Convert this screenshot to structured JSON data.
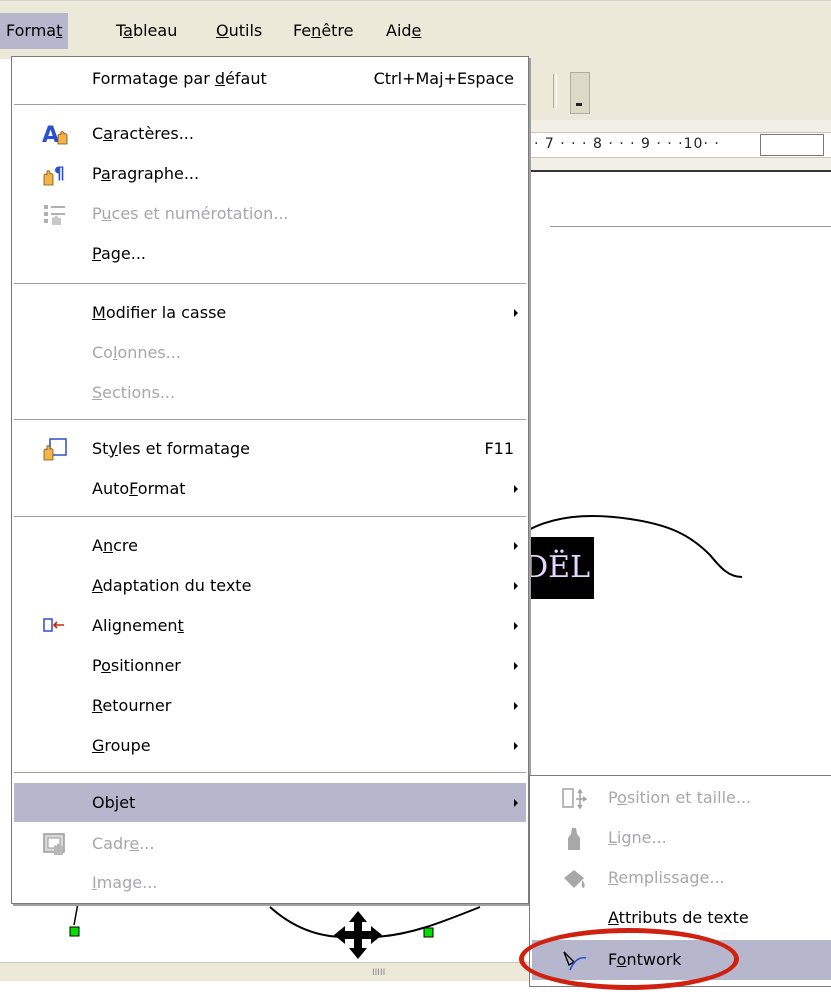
{
  "menubar": {
    "items": [
      {
        "pre": "Forma",
        "u": "t",
        "post": ""
      },
      {
        "pre": "T",
        "u": "a",
        "post": "bleau"
      },
      {
        "pre": "",
        "u": "O",
        "post": "utils"
      },
      {
        "pre": "Fe",
        "u": "n",
        "post": "être"
      },
      {
        "pre": "Aid",
        "u": "e",
        "post": ""
      }
    ]
  },
  "ruler": {
    "marks": "· 7 · · · 8 · · · 9 · · ·10· ·"
  },
  "document": {
    "text_box": "DËL"
  },
  "format_menu": {
    "items": [
      {
        "pre": "Formatage par ",
        "u": "d",
        "post": "éfaut",
        "shortcut": "Ctrl+Maj+Espace",
        "icon": "none"
      },
      {
        "pre": "C",
        "u": "a",
        "post": "ractères...",
        "icon": "character-icon"
      },
      {
        "pre": "P",
        "u": "a",
        "post": "ragraphe...",
        "icon": "paragraph-icon"
      },
      {
        "pre": "P",
        "u": "u",
        "post": "ces et numérotation...",
        "icon": "bullets-icon"
      },
      {
        "pre": "",
        "u": "P",
        "post": "age...",
        "icon": "none"
      },
      {
        "pre": "",
        "u": "M",
        "post": "odifier la casse",
        "icon": "none"
      },
      {
        "pre": "Co",
        "u": "l",
        "post": "onnes...",
        "icon": "none"
      },
      {
        "pre": "",
        "u": "S",
        "post": "ections...",
        "icon": "none"
      },
      {
        "pre": "St",
        "u": "y",
        "post": "les et formatage",
        "shortcut": "F11",
        "icon": "styles-icon"
      },
      {
        "pre": "Auto",
        "u": "F",
        "post": "ormat",
        "icon": "none"
      },
      {
        "pre": "A",
        "u": "n",
        "post": "cre",
        "icon": "none"
      },
      {
        "pre": "",
        "u": "A",
        "post": "daptation du texte",
        "icon": "none"
      },
      {
        "pre": "Alignemen",
        "u": "t",
        "post": "",
        "icon": "alignment-icon"
      },
      {
        "pre": "P",
        "u": "o",
        "post": "sitionner",
        "icon": "none"
      },
      {
        "pre": "",
        "u": "R",
        "post": "etourner",
        "icon": "none"
      },
      {
        "pre": "",
        "u": "G",
        "post": "roupe",
        "icon": "none"
      },
      {
        "pre": "Ob",
        "u": "j",
        "post": "et",
        "icon": "none"
      },
      {
        "pre": "Cadr",
        "u": "e",
        "post": "...",
        "icon": "frame-icon"
      },
      {
        "pre": "",
        "u": "I",
        "post": "mage...",
        "icon": "none"
      }
    ]
  },
  "objet_menu": {
    "items": [
      {
        "pre": "P",
        "u": "o",
        "post": "sition et taille...",
        "icon": "position-size-icon"
      },
      {
        "pre": "",
        "u": "L",
        "post": "igne...",
        "icon": "line-icon"
      },
      {
        "pre": "",
        "u": "R",
        "post": "emplissage...",
        "icon": "fill-icon"
      },
      {
        "pre": "",
        "u": "A",
        "post": "ttributs de texte",
        "icon": "none"
      },
      {
        "pre": "F",
        "u": "o",
        "post": "ntwork",
        "icon": "fontwork-icon"
      }
    ]
  },
  "colors": {
    "menu_highlight": "#b6b6cc",
    "disabled_text": "#a7a6aa",
    "annotation": "#d02010"
  }
}
